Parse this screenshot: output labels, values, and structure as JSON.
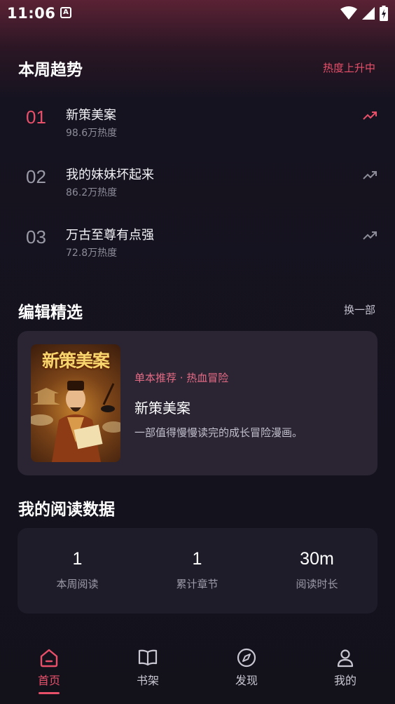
{
  "status_bar": {
    "time": "11:06",
    "app_icon_letter": "A",
    "icons": [
      "wifi-icon",
      "signal-icon",
      "battery-charging-icon"
    ]
  },
  "trends": {
    "title": "本周趋势",
    "status": "热度上升中",
    "items": [
      {
        "rank": "01",
        "title": "新策美案",
        "heat": "98.6万热度",
        "highlighted": true
      },
      {
        "rank": "02",
        "title": "我的妹妹坏起来",
        "heat": "86.2万热度",
        "highlighted": false
      },
      {
        "rank": "03",
        "title": "万古至尊有点强",
        "heat": "72.8万热度",
        "highlighted": false
      }
    ]
  },
  "editor_pick": {
    "title": "编辑精选",
    "action": "换一部",
    "cover_text": "新策美案",
    "tag": "单本推荐 · 热血冒险",
    "book_title": "新策美案",
    "description": "一部值得慢慢读完的成长冒险漫画。"
  },
  "reading_stats": {
    "title": "我的阅读数据",
    "items": [
      {
        "value": "1",
        "label": "本周阅读"
      },
      {
        "value": "1",
        "label": "累计章节"
      },
      {
        "value": "30m",
        "label": "阅读时长"
      }
    ]
  },
  "nav": {
    "items": [
      {
        "label": "首页",
        "icon": "home-icon",
        "active": true
      },
      {
        "label": "书架",
        "icon": "book-icon",
        "active": false
      },
      {
        "label": "发现",
        "icon": "compass-icon",
        "active": false
      },
      {
        "label": "我的",
        "icon": "user-icon",
        "active": false
      }
    ]
  },
  "colors": {
    "accent": "#e8506a",
    "background": "#13121b",
    "card": "#2a2433"
  }
}
